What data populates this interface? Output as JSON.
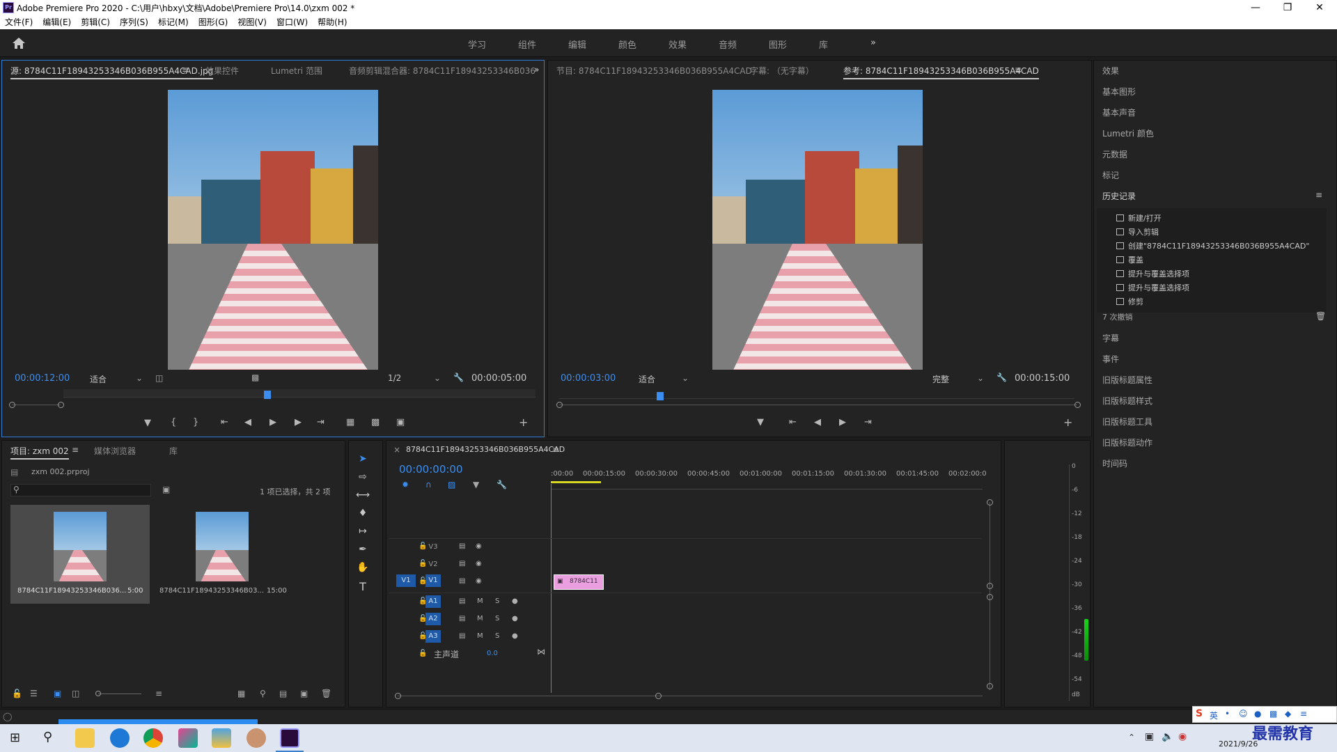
{
  "app": {
    "title": "Adobe Premiere Pro 2020 - C:\\用户\\hbxy\\文档\\Adobe\\Premiere Pro\\14.0\\zxm  002 *",
    "logo": "Pr"
  },
  "menu": [
    "文件(F)",
    "编辑(E)",
    "剪辑(C)",
    "序列(S)",
    "标记(M)",
    "图形(G)",
    "视图(V)",
    "窗口(W)",
    "帮助(H)"
  ],
  "workspaces": [
    "学习",
    "组件",
    "编辑",
    "颜色",
    "效果",
    "音频",
    "图形",
    "库"
  ],
  "source": {
    "tabs": [
      "源: 8784C11F18943253346B036B955A4CAD.jpg",
      "效果控件",
      "Lumetri 范围",
      "音频剪辑混合器: 8784C11F18943253346B036"
    ],
    "timecode": "00:00:12:00",
    "fit": "适合",
    "resolution": "1/2",
    "duration": "00:00:05:00"
  },
  "program": {
    "tabs": [
      "节目: 8784C11F18943253346B036B955A4CAD",
      "字幕: （无字幕）",
      "参考: 8784C11F18943253346B036B955A4CAD"
    ],
    "timecode": "00:00:03:00",
    "fit": "适合",
    "quality": "完整",
    "duration": "00:00:15:00"
  },
  "right_panel": {
    "items_top": [
      "效果",
      "基本图形",
      "基本声音",
      "Lumetri 颜色",
      "元数据",
      "标记"
    ],
    "history_title": "历史记录",
    "history": [
      "新建/打开",
      "导入剪辑",
      "创建\"8784C11F18943253346B036B955A4CAD\"",
      "覆盖",
      "提升与覆盖选择项",
      "提升与覆盖选择项",
      "修剪"
    ],
    "undo_count": "7 次撤销",
    "items_bottom": [
      "字幕",
      "事件",
      "旧版标题属性",
      "旧版标题样式",
      "旧版标题工具",
      "旧版标题动作",
      "时间码"
    ]
  },
  "project": {
    "tabs": [
      "项目: zxm  002",
      "媒体浏览器",
      "库"
    ],
    "file": "zxm  002.prproj",
    "selection": "1 项已选择，共 2 项",
    "items": [
      {
        "name": "8784C11F18943253346B036...",
        "duration": "5:00"
      },
      {
        "name": "8784C11F18943253346B03...",
        "duration": "15:00"
      }
    ]
  },
  "timeline": {
    "tab": "8784C11F18943253346B036B955A4CAD",
    "timecode": "00:00:00:00",
    "ruler": [
      ":00:00",
      "00:00:15:00",
      "00:00:30:00",
      "00:00:45:00",
      "00:01:00:00",
      "00:01:15:00",
      "00:01:30:00",
      "00:01:45:00",
      "00:02:00:0"
    ],
    "video_tracks": [
      "V3",
      "V2",
      "V1"
    ],
    "audio_tracks": [
      "A1",
      "A2",
      "A3"
    ],
    "source_patch_v": "V1",
    "mute_label": "M",
    "solo_label": "S",
    "master": "主声道",
    "master_value": "0.0",
    "clip": "8784C11"
  },
  "meter": {
    "scale": [
      "0",
      "-6",
      "-12",
      "-18",
      "-24",
      "-30",
      "-36",
      "-42",
      "-48",
      "-54",
      "dB"
    ]
  },
  "taskbar": {
    "date": "2021/9/26",
    "watermark": "最需教育",
    "ime": "英"
  },
  "colors": {
    "accent": "#2f7bd8",
    "timecode": "#3b8ef0",
    "clip": "#e99fe0",
    "track_on": "#1f5aa8"
  }
}
